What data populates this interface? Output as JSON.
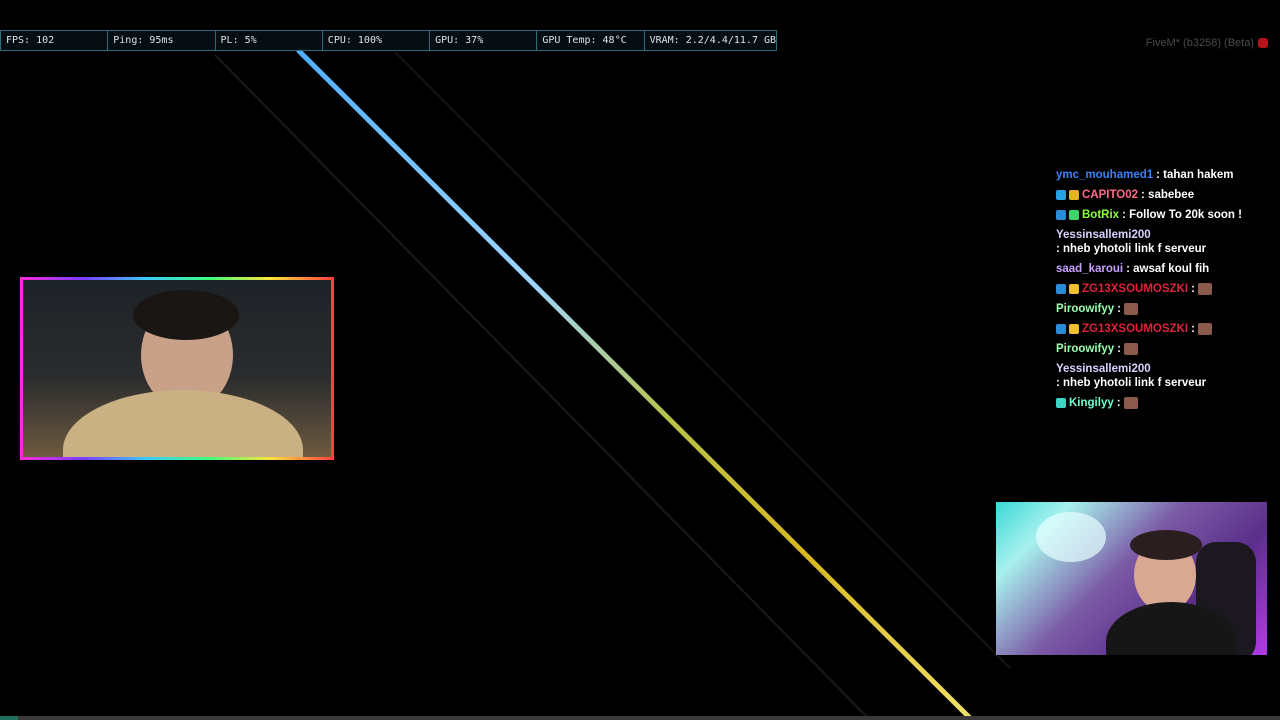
{
  "perf": {
    "fps": "FPS: 102",
    "ping": "Ping: 95ms",
    "pl": "PL: 5%",
    "cpu": "CPU: 100%",
    "gpu": "GPU: 37%",
    "gpu_temp": "GPU Temp: 48°C",
    "vram": "VRAM: 2.2/4.4/11.7 GB"
  },
  "build_label": "FiveM* (b3258) (Beta)",
  "colors": {
    "streak_top": "#4fb0ff",
    "streak_bottom": "#c9c24a",
    "perf_border": "#2f6b7d"
  },
  "chat": [
    {
      "user": "ymc_mouhamed1",
      "color": "#3b82f6",
      "text": ": tahan hakem",
      "badges": []
    },
    {
      "user": "CAPITO02",
      "color": "#ff6b8a",
      "text": ": sabebee",
      "badges": [
        "#27a4e6",
        "#e6b422"
      ]
    },
    {
      "user": "BotRix",
      "color": "#8bff3c",
      "text": ": Follow To 20k soon !",
      "badges": [
        "#2a8bd8",
        "#3cd46b"
      ]
    },
    {
      "user": "Yessinsallemi200",
      "color": "#d9d2ff",
      "text": ": nheb yhotoli link f serveur",
      "badges": []
    },
    {
      "user": "saad_karoui",
      "color": "#c9a0ff",
      "text": ": awsaf koul fih",
      "badges": []
    },
    {
      "user": "ZG13XSOUMOSZKI",
      "color": "#e0233a",
      "text": ":",
      "badges": [
        "#2a8bd8",
        "#f2c22e"
      ],
      "emote": true
    },
    {
      "user": "Piroowifyy",
      "color": "#9bffb0",
      "text": ":",
      "badges": [],
      "emote": true
    },
    {
      "user": "ZG13XSOUMOSZKI",
      "color": "#e0233a",
      "text": ":",
      "badges": [
        "#2a8bd8",
        "#f2c22e"
      ],
      "emote": true
    },
    {
      "user": "Piroowifyy",
      "color": "#9bffb0",
      "text": ":",
      "badges": [],
      "emote": true
    },
    {
      "user": "Yessinsallemi200",
      "color": "#d9d2ff",
      "text": ": nheb yhotoli link f serveur",
      "badges": []
    },
    {
      "user": "Kingilyy",
      "color": "#6effd2",
      "text": ":",
      "badges": [
        "#3cd4c4"
      ],
      "emote": true
    }
  ]
}
